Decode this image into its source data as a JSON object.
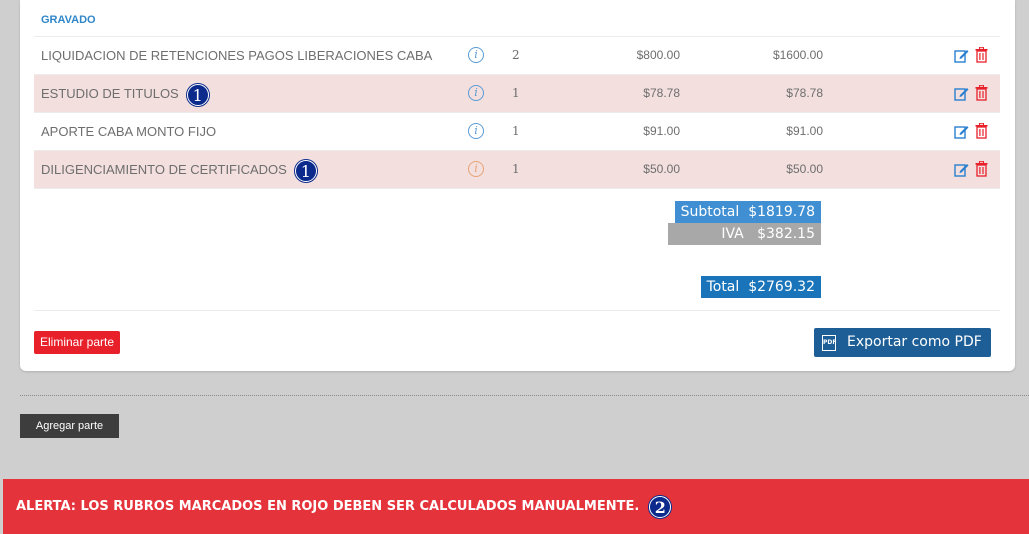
{
  "section": {
    "title": "GRAVADO"
  },
  "rows": [
    {
      "description": "LIQUIDACION DE RETENCIONES PAGOS LIBERACIONES CABA",
      "info": "i",
      "qty": "2",
      "price": "$800.00",
      "total": "$1600.00",
      "marked": false,
      "badge": ""
    },
    {
      "description": "ESTUDIO DE TITULOS",
      "info": "i",
      "qty": "1",
      "price": "$78.78",
      "total": "$78.78",
      "marked": true,
      "badge": "1"
    },
    {
      "description": "APORTE CABA MONTO FIJO",
      "info": "i",
      "qty": "1",
      "price": "$91.00",
      "total": "$91.00",
      "marked": false,
      "badge": ""
    },
    {
      "description": "DILIGENCIAMIENTO DE CERTIFICADOS",
      "info": "i",
      "qty": "1",
      "price": "$50.00",
      "total": "$50.00",
      "marked": true,
      "badge": "1"
    }
  ],
  "totals": {
    "subtotal_label": "Subtotal",
    "subtotal_value": "$1819.78",
    "iva_label": "IVA",
    "iva_value": "$382.15",
    "total_label": "Total",
    "total_value": "$2769.32"
  },
  "buttons": {
    "delete_part": "Eliminar parte",
    "export_pdf": "Exportar como PDF",
    "pdf_icon_text": "PDF",
    "add_part": "Agregar parte"
  },
  "alert": {
    "text": "ALERTA: LOS RUBROS MARCADOS EN ROJO DEBEN SER CALCULADOS MANUALMENTE.",
    "badge": "2"
  },
  "colors": {
    "marked_row": "#f2dfde",
    "accent_blue": "#2f86c9",
    "alert_red": "#e5333b",
    "delete_red": "#e8202a"
  },
  "icons": {
    "info": "info-icon",
    "edit": "edit-icon",
    "delete": "trash-icon",
    "pdf": "pdf-icon"
  }
}
